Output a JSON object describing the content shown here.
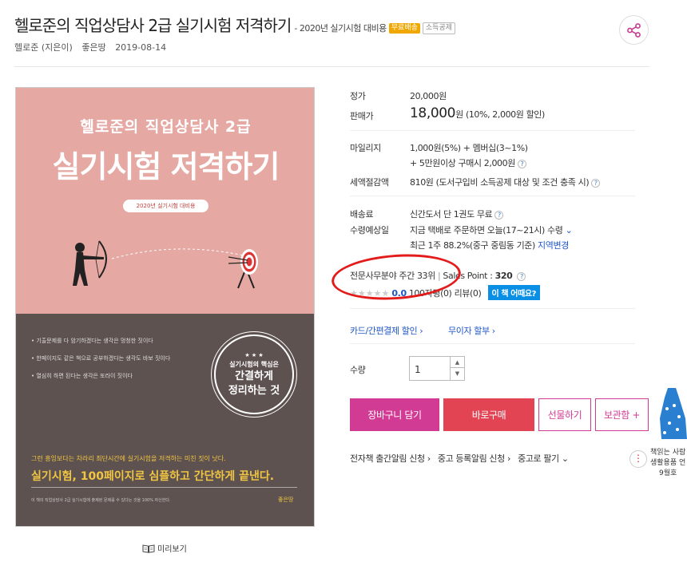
{
  "header": {
    "title": "헬로준의 직업상담사 2급 실기시험 저격하기",
    "subtitle": "- 2020년 실기시험 대비용",
    "badge_free": "무료배송",
    "badge_deduction": "소득공제",
    "author": "헬로준 (지은이)",
    "publisher": "좋은땅",
    "date": "2019-08-14"
  },
  "cover": {
    "title_line1": "헬로준의 직업상담사 2급",
    "title_line2": "실기시험 저격하기",
    "pill": "2020년 실기시험 대비용",
    "bullets": [
      "• 기출문제를 다 암기하겠다는 생각은 멍청한 짓이다",
      "• 한페이지도 같은 책으로 공부하겠다는 생각도 바보 짓이다",
      "• 열심히 하면 된다는 생각은 또라이 짓이다"
    ],
    "circle_stars": "★ ★ ★",
    "circle_line1": "실기시험의 핵심은",
    "circle_line2": "간결하게",
    "circle_line3": "정리하는 것",
    "summary1": "그런 흥잉보다는 차라리 최단시간에 실기시험을 저격하는 미친 짓이 낫다.",
    "summary2": "실기시험, 100페이지로 심플하고 간단하게 끝낸다.",
    "fineprint": "이 책의 직업상담사 2급 실기시험에 출제된 문제를 수 있다는 것을 100% 자신한다.",
    "publisher_logo": "좋은땅",
    "preview_label": "미리보기"
  },
  "price": {
    "list_label": "정가",
    "list_value": "20,000원",
    "sale_label": "판매가",
    "sale_value": "18,000",
    "sale_unit": "원",
    "sale_discount": "(10%, 2,000원 할인)"
  },
  "mileage": {
    "label": "마일리지",
    "line1": "1,000원(5%) + 멤버십(3~1%)",
    "line2": "+ 5만원이상 구매시 2,000원",
    "deduction_label": "세액절감액",
    "deduction_value": "810원 (도서구입비 소득공제 대상 및 조건 충족 시)"
  },
  "delivery": {
    "fee_label": "배송료",
    "fee_value": "신간도서 단 1권도 무료",
    "eta_label": "수령예상일",
    "eta_value": "지금 택배로 주문하면 오늘(17~21시) 수령",
    "eta_stats": "최근 1주 88.2%(중구 중림동 기준)",
    "region_link": "지역변경"
  },
  "ranking": {
    "rank_text": "전문사무분야 주간 33위",
    "sales_point_label": "Sales Point :",
    "sales_point_value": "320",
    "stars": "★★★★★",
    "score": "0.0",
    "reviews_100": "100자평(0)",
    "reviews": "리뷰(0)",
    "rate_button": "이 책 어때요?"
  },
  "promos": {
    "card_discount": "카드/간편결제 할인 ›",
    "installment": "무이자 할부 ›"
  },
  "quantity": {
    "label": "수량",
    "value": "1"
  },
  "buttons": {
    "cart": "장바구니 담기",
    "buy": "바로구매",
    "gift": "선물하기",
    "store": "보관함 +"
  },
  "links": {
    "ebook": "전자책 출간알림 신청 ›",
    "used_alert": "중고 등록알림 신청 ›",
    "sell_used": "중고로 팔기 ⌄"
  },
  "side": {
    "text1": "책읽는 사람",
    "text2": "생활용품 언",
    "text3": "9월호"
  }
}
